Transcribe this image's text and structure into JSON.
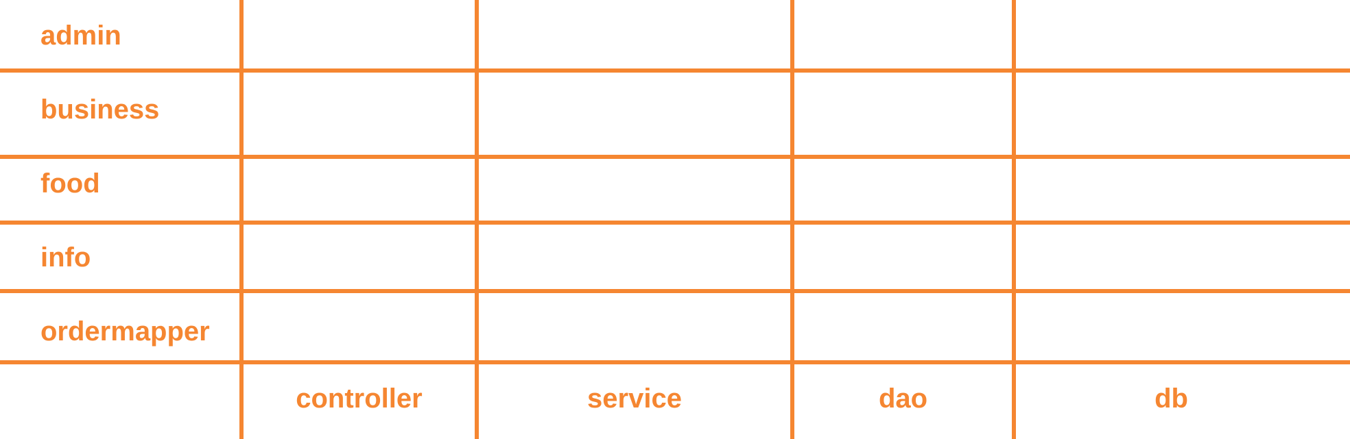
{
  "matrix": {
    "accent_color": "#F58631",
    "rows": [
      {
        "label": "admin"
      },
      {
        "label": "business"
      },
      {
        "label": "food"
      },
      {
        "label": "info"
      },
      {
        "label": "ordermapper"
      }
    ],
    "columns": [
      {
        "label": "controller"
      },
      {
        "label": "service"
      },
      {
        "label": "dao"
      },
      {
        "label": "db"
      }
    ]
  }
}
